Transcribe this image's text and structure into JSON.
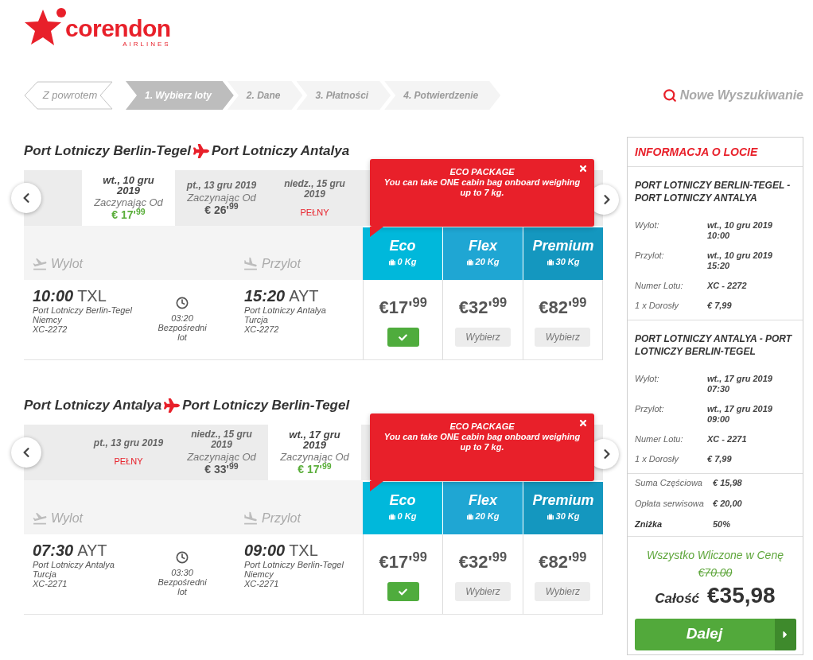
{
  "logo": {
    "name": "corendon",
    "tagline": "AIRLINES"
  },
  "back_button": "Z powrotem",
  "steps": [
    {
      "label": "1. Wybierz loty",
      "selected": true
    },
    {
      "label": "2. Dane",
      "selected": false
    },
    {
      "label": "3. Płatności",
      "selected": false
    },
    {
      "label": "4. Potwierdzenie",
      "selected": false
    }
  ],
  "new_search": "Nowe Wyszukiwanie",
  "flights": [
    {
      "from": "Port Lotniczy Berlin-Tegel",
      "to": "Port Lotniczy Antalya",
      "dates": [
        {
          "kind": "price",
          "date": "wt., 10 gru 2019",
          "from_label": "Zaczynając Od",
          "price": "€ 17'$^{99}$",
          "selected": true
        },
        {
          "kind": "price",
          "date": "pt., 13 gru 2019",
          "from_label": "Zaczynając Od",
          "price": "€ 26'$^{99}$",
          "selected": false
        },
        {
          "kind": "full",
          "date": "niedz., 15 gru 2019",
          "status": "PEŁNY",
          "selected": false
        }
      ],
      "popup": {
        "title": "ECO PACKAGE",
        "text": "You can take ONE cabin bag onboard weighing up to 7 kg."
      },
      "departure_header": "Wylot",
      "arrival_header": "Przylot",
      "fares": [
        {
          "name": "Eco",
          "baggage": "0 Kg",
          "color": "#00b8db",
          "price": "€17'$^{99}$",
          "selected": true
        },
        {
          "name": "Flex",
          "baggage": "20 Kg",
          "color": "#1fa6d3",
          "price": "€32'$^{99}$",
          "selected": false,
          "button": "Wybierz"
        },
        {
          "name": "Premium",
          "baggage": "30 Kg",
          "color": "#1497bf",
          "price": "€82'$^{99}$",
          "selected": false,
          "button": "Wybierz"
        }
      ],
      "departure": {
        "time": "10:00",
        "code": "TXL",
        "airport": "Port Lotniczy Berlin-Tegel",
        "country": "Niemcy",
        "flight": "XC-2272"
      },
      "duration": "03:20",
      "stops": "Bezpośredni lot",
      "arrival": {
        "time": "15:20",
        "code": "AYT",
        "airport": "Port Lotniczy Antalya",
        "country": "Turcja",
        "flight": "XC-2272"
      }
    },
    {
      "from": "Port Lotniczy Antalya",
      "to": "Port Lotniczy Berlin-Tegel",
      "dates": [
        {
          "kind": "full",
          "date": "pt., 13 gru 2019",
          "status": "PEŁNY",
          "selected": false
        },
        {
          "kind": "price",
          "date": "niedz., 15 gru 2019",
          "from_label": "Zaczynając Od",
          "price": "€ 33'$^{99}$",
          "selected": false
        },
        {
          "kind": "price",
          "date": "wt., 17 gru 2019",
          "from_label": "Zaczynając Od",
          "price": "€ 17'$^{99}$",
          "selected": true
        }
      ],
      "popup": {
        "title": "ECO PACKAGE",
        "text": "You can take ONE cabin bag onboard weighing up to 7 kg."
      },
      "departure_header": "Wylot",
      "arrival_header": "Przylot",
      "fares": [
        {
          "name": "Eco",
          "baggage": "0 Kg",
          "color": "#00b8db",
          "price": "€17'$^{99}$",
          "selected": true
        },
        {
          "name": "Flex",
          "baggage": "20 Kg",
          "color": "#1fa6d3",
          "price": "€32'$^{99}$",
          "selected": false,
          "button": "Wybierz"
        },
        {
          "name": "Premium",
          "baggage": "30 Kg",
          "color": "#1497bf",
          "price": "€82'$^{99}$",
          "selected": false,
          "button": "Wybierz"
        }
      ],
      "departure": {
        "time": "07:30",
        "code": "AYT",
        "airport": "Port Lotniczy Antalya",
        "country": "Turcja",
        "flight": "XC-2271"
      },
      "duration": "03:30",
      "stops": "Bezpośredni lot",
      "arrival": {
        "time": "09:00",
        "code": "TXL",
        "airport": "Port Lotniczy Berlin-Tegel",
        "country": "Niemcy",
        "flight": "XC-2271"
      }
    }
  ],
  "summary": {
    "title": "INFORMACJA O LOCIE",
    "segments": [
      {
        "route": "PORT LOTNICZY BERLIN-TEGEL - PORT LOTNICZY ANTALYA",
        "rows": [
          {
            "label": "Wylot:",
            "value": "wt., 10 gru 2019",
            "time": "10:00"
          },
          {
            "label": "Przylot:",
            "value": "wt., 10 gru 2019",
            "time": "15:20"
          },
          {
            "label": "Numer Lotu:",
            "value": "XC - 2272"
          },
          {
            "label": "1 x Dorosły",
            "value": "€ 7,99"
          }
        ]
      },
      {
        "route": "PORT LOTNICZY ANTALYA - PORT LOTNICZY BERLIN-TEGEL",
        "rows": [
          {
            "label": "Wylot:",
            "value": "wt., 17 gru 2019",
            "time": "07:30"
          },
          {
            "label": "Przylot:",
            "value": "wt., 17 gru 2019",
            "time": "09:00"
          },
          {
            "label": "Numer Lotu:",
            "value": "XC - 2271"
          },
          {
            "label": "1 x Dorosły",
            "value": "€ 7,99"
          }
        ]
      }
    ],
    "totals": [
      {
        "kind": "line",
        "label": "Suma Częściowa",
        "value": "€ 15,98"
      },
      {
        "kind": "line",
        "label": "Opłata serwisowa",
        "value": "€ 20,00"
      },
      {
        "kind": "discount",
        "label": "Zniżka",
        "value": "50%"
      }
    ],
    "included": "Wszystko Wliczone w Cenę",
    "old_price": "€70.00",
    "total_label": "Całość",
    "total": "€35,98",
    "button": "Dalej"
  }
}
